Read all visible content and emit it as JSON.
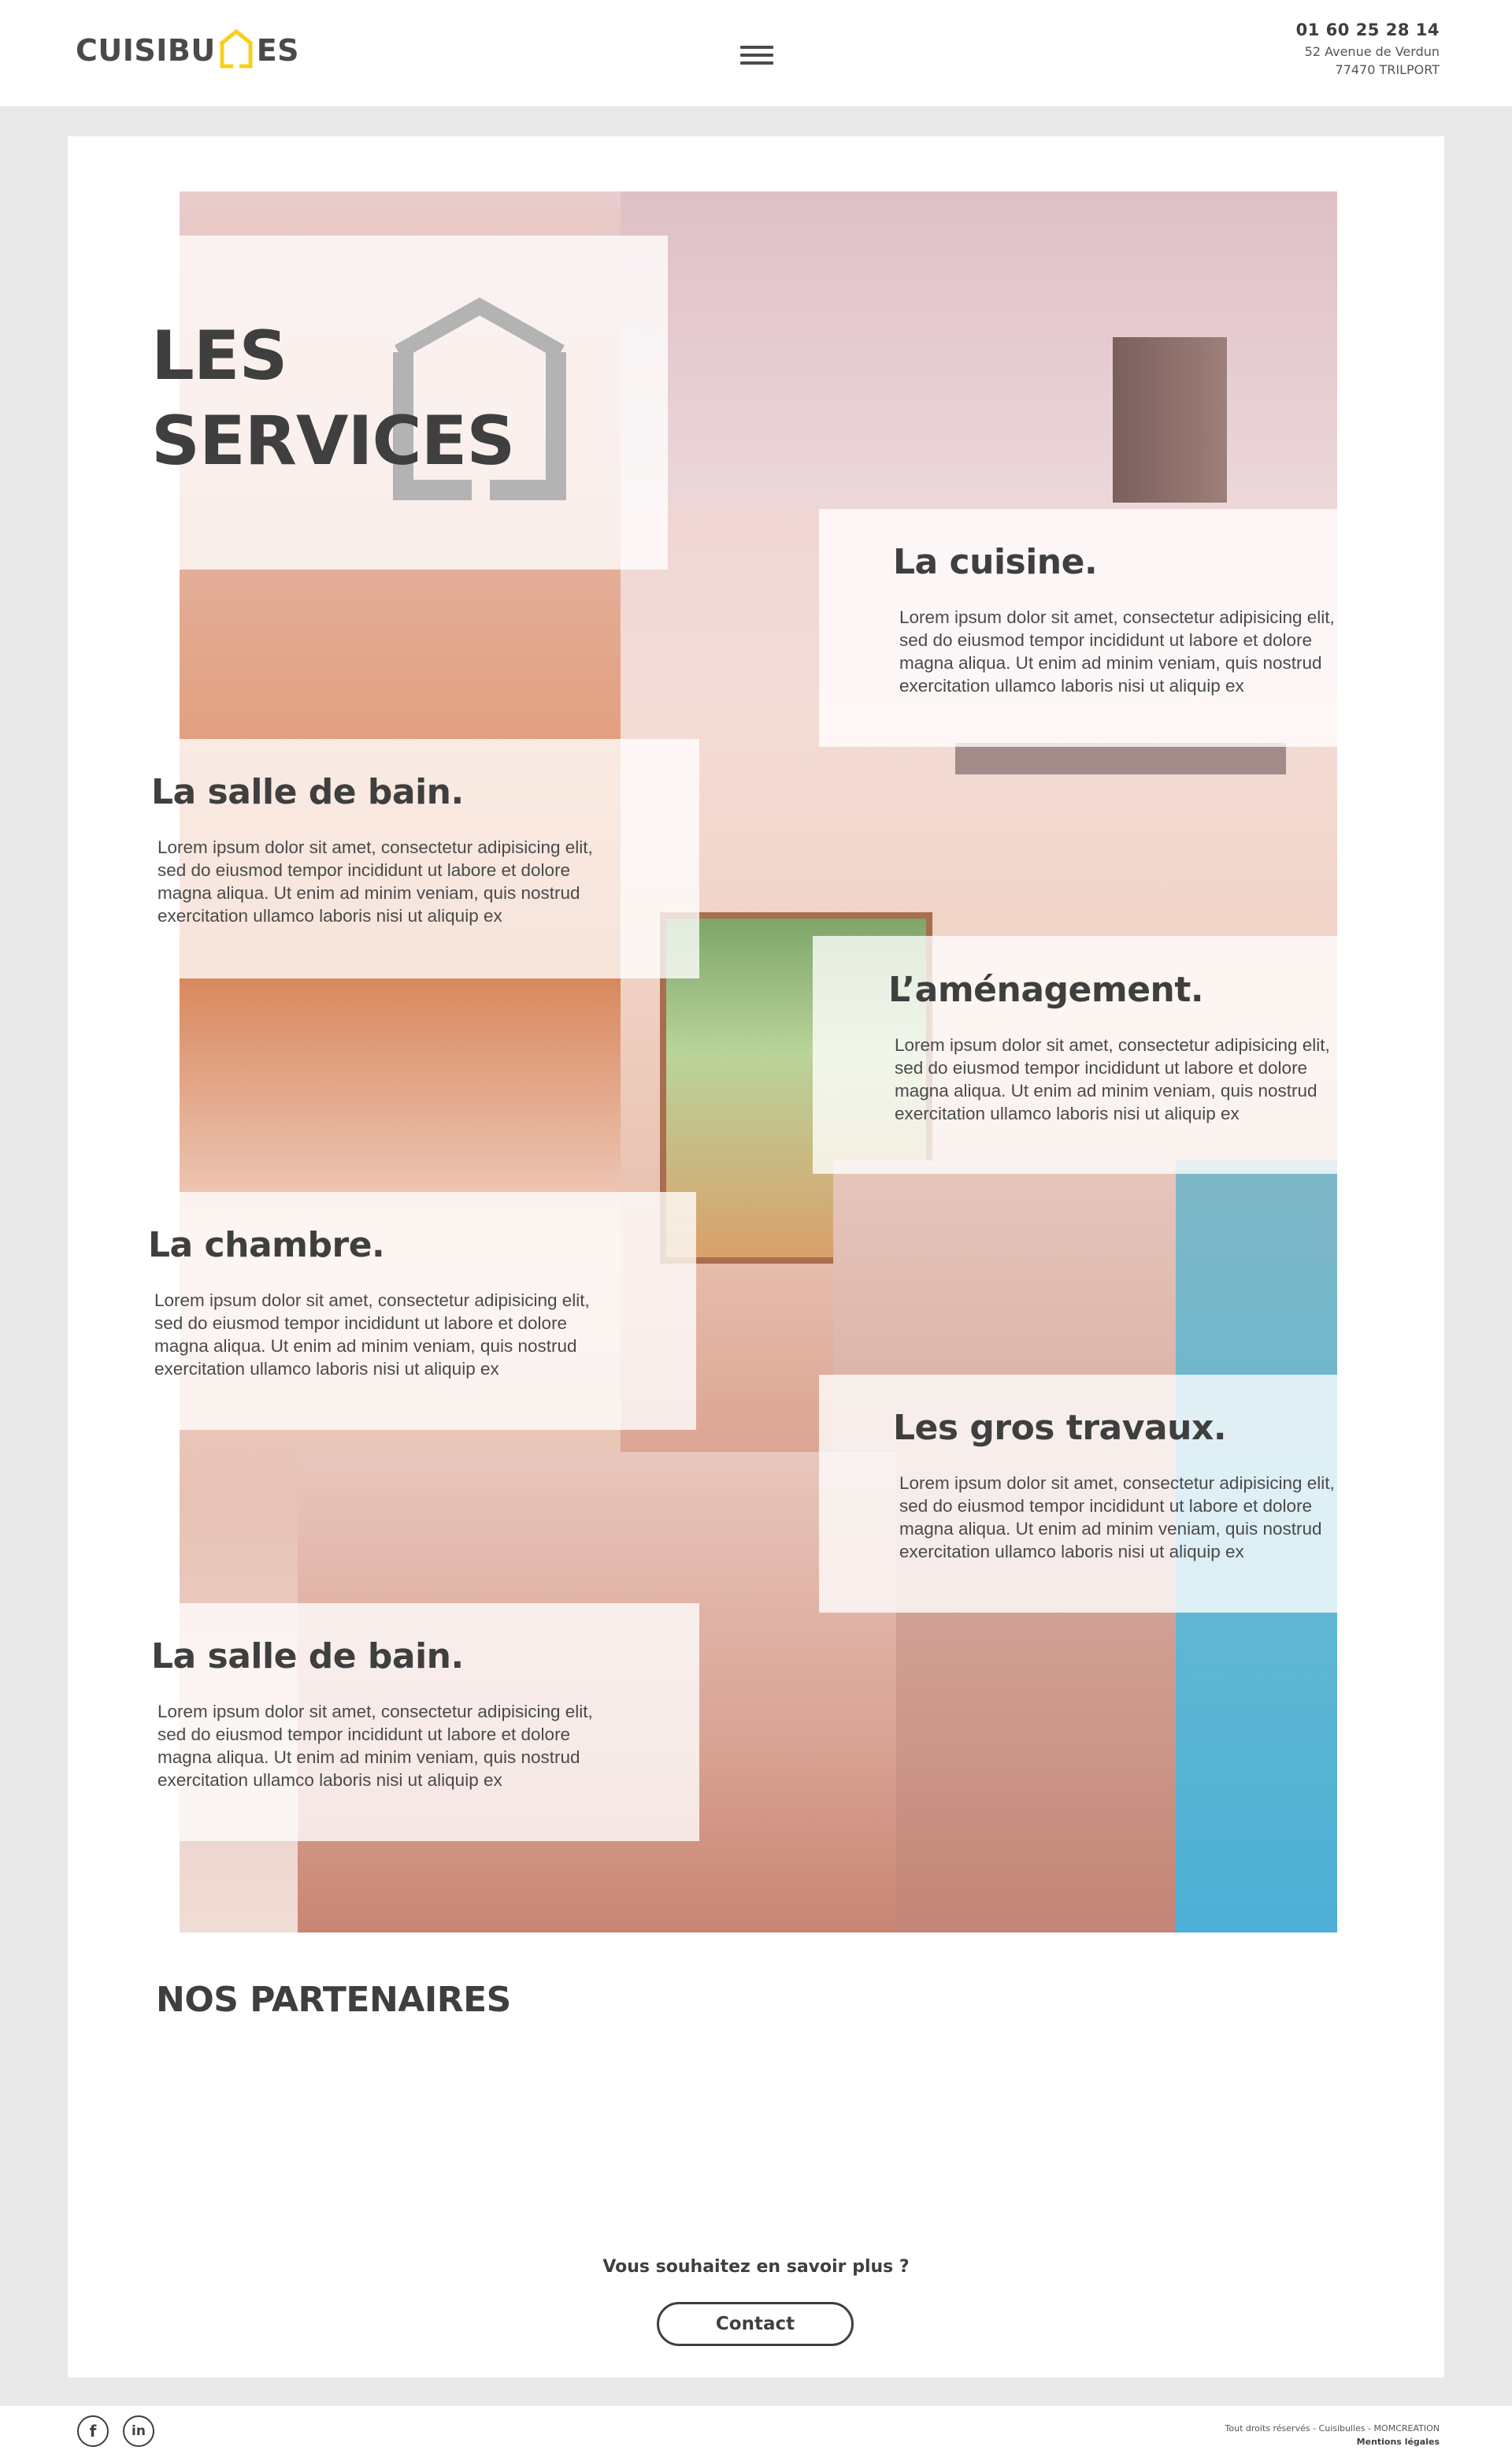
{
  "header": {
    "logo_text_left": "CUISIBU",
    "logo_text_right": "ES",
    "phone": "01 60 25 28 14",
    "address_line1": "52 Avenue de Verdun",
    "address_line2": "77470 TRILPORT",
    "logo_accent_color": "#f4d01c"
  },
  "hero": {
    "title_line1": "LES",
    "title_line2": "SERVICES"
  },
  "services": [
    {
      "title": "La cuisine.",
      "text": "Lorem ipsum dolor sit amet, consectetur adipisicing elit, sed do eiusmod tempor incididunt ut labore et dolore magna aliqua. Ut enim ad minim veniam, quis nostrud exercitation ullamco laboris nisi ut aliquip ex"
    },
    {
      "title": "La salle de bain.",
      "text": "Lorem ipsum dolor sit amet, consectetur adipisicing elit, sed do eiusmod tempor incididunt ut labore et dolore magna aliqua. Ut enim ad minim veniam, quis nostrud exercitation ullamco laboris nisi ut aliquip ex"
    },
    {
      "title": "L’aménagement.",
      "text": "Lorem ipsum dolor sit amet, consectetur adipisicing elit, sed do eiusmod tempor incididunt ut labore et dolore magna aliqua. Ut enim ad minim veniam, quis nostrud exercitation ullamco laboris nisi ut aliquip ex"
    },
    {
      "title": "La chambre.",
      "text": "Lorem ipsum dolor sit amet, consectetur adipisicing elit, sed do eiusmod tempor incididunt ut labore et dolore magna aliqua. Ut enim ad minim veniam, quis nostrud exercitation ullamco laboris nisi ut aliquip ex"
    },
    {
      "title": "Les gros travaux.",
      "text": "Lorem ipsum dolor sit amet, consectetur adipisicing elit, sed do eiusmod tempor incididunt ut labore et dolore magna aliqua. Ut enim ad minim veniam, quis nostrud exercitation ullamco laboris nisi ut aliquip ex"
    },
    {
      "title": "La salle de bain.",
      "text": "Lorem ipsum dolor sit amet, consectetur adipisicing elit, sed do eiusmod tempor incididunt ut labore et dolore magna aliqua. Ut enim ad minim veniam, quis nostrud exercitation ullamco laboris nisi ut aliquip ex"
    }
  ],
  "partners": {
    "title": "NOS PARTENAIRES"
  },
  "cta": {
    "question": "Vous souhaitez en savoir plus ?",
    "button_label": "Contact"
  },
  "footer": {
    "facebook_glyph": "f",
    "linkedin_glyph": "in",
    "copyright": "Tout droits réservés - Cuisibulles - MOMCREATION",
    "legal_link": "Mentions légales"
  }
}
